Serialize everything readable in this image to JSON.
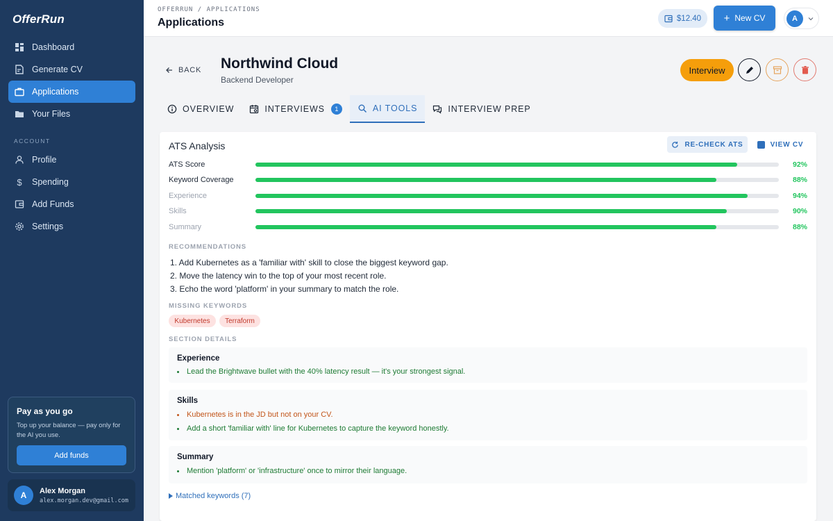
{
  "app": {
    "logo": "OfferRun"
  },
  "sidebar": {
    "items": [
      {
        "label": "Dashboard",
        "icon": "dashboard-icon"
      },
      {
        "label": "Generate CV",
        "icon": "document-edit-icon"
      },
      {
        "label": "Applications",
        "icon": "briefcase-icon",
        "active": true
      },
      {
        "label": "Your Files",
        "icon": "folder-icon"
      }
    ],
    "account_section": "ACCOUNT",
    "account_items": [
      {
        "label": "Profile",
        "icon": "user-icon"
      },
      {
        "label": "Spending",
        "icon": "dollar-icon"
      },
      {
        "label": "Add Funds",
        "icon": "wallet-icon"
      },
      {
        "label": "Settings",
        "icon": "gear-icon"
      }
    ],
    "payg": {
      "title": "Pay as you go",
      "text": "Top up your balance — pay only for the AI you use.",
      "button": "Add funds"
    },
    "user": {
      "initial": "A",
      "name": "Alex Morgan",
      "email": "alex.morgan.dev@gmail.com"
    }
  },
  "topbar": {
    "breadcrumb": "OFFERRUN / APPLICATIONS",
    "title": "Applications",
    "balance": "$12.40",
    "new_cv": "New CV",
    "avatar_initial": "A"
  },
  "header": {
    "back": "BACK",
    "company": "Northwind Cloud",
    "role": "Backend Developer",
    "status": "Interview"
  },
  "tabs": [
    {
      "label": "OVERVIEW",
      "icon": "info-icon"
    },
    {
      "label": "INTERVIEWS",
      "icon": "calendar-icon",
      "badge": "1"
    },
    {
      "label": "AI TOOLS",
      "icon": "search-icon",
      "active": true
    },
    {
      "label": "INTERVIEW PREP",
      "icon": "chat-icon"
    }
  ],
  "ats": {
    "title": "ATS Analysis",
    "recheck": "RE-CHECK ATS",
    "view_cv": "VIEW CV",
    "metrics": [
      {
        "label": "ATS Score",
        "value": 92,
        "display": "92%"
      },
      {
        "label": "Keyword Coverage",
        "value": 88,
        "display": "88%"
      },
      {
        "label": "Experience",
        "value": 94,
        "display": "94%"
      },
      {
        "label": "Skills",
        "value": 90,
        "display": "90%"
      },
      {
        "label": "Summary",
        "value": 88,
        "display": "88%"
      }
    ],
    "recommendations_label": "RECOMMENDATIONS",
    "recommendations": [
      "1. Add Kubernetes as a 'familiar with' skill to close the biggest keyword gap.",
      "2. Move the latency win to the top of your most recent role.",
      "3. Echo the word 'platform' in your summary to match the role."
    ],
    "missing_label": "MISSING KEYWORDS",
    "missing_keywords": [
      "Kubernetes",
      "Terraform"
    ],
    "details_label": "SECTION DETAILS",
    "sections": [
      {
        "title": "Experience",
        "bullets": [
          {
            "text": "Lead the Brightwave bullet with the 40% latency result — it's your strongest signal.",
            "tone": "good"
          }
        ]
      },
      {
        "title": "Skills",
        "bullets": [
          {
            "text": "Kubernetes is in the JD but not on your CV.",
            "tone": "warn"
          },
          {
            "text": "Add a short 'familiar with' line for Kubernetes to capture the keyword honestly.",
            "tone": "good"
          }
        ]
      },
      {
        "title": "Summary",
        "bullets": [
          {
            "text": "Mention 'platform' or 'infrastructure' once to mirror their language.",
            "tone": "good"
          }
        ]
      }
    ],
    "matched": "Matched keywords (7)"
  },
  "colors": {
    "sidebar": "#1e3a5f",
    "accent": "#2f80d6",
    "status": "#f59e0b",
    "success": "#22c55e",
    "danger": "#c0392b"
  }
}
